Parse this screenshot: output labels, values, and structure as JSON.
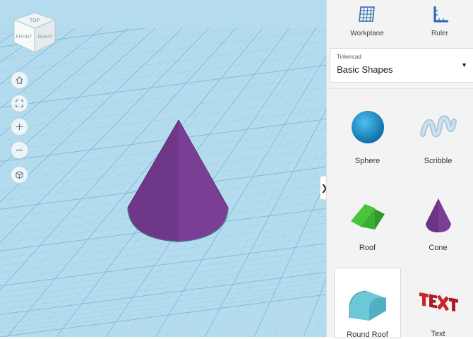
{
  "viewcube": {
    "top": "TOP",
    "front": "FRONT",
    "right": "RIGHT"
  },
  "nav": [
    {
      "name": "home-view-button",
      "icon": "home-icon"
    },
    {
      "name": "fit-view-button",
      "icon": "fit-icon"
    },
    {
      "name": "zoom-in-button",
      "icon": "plus-icon"
    },
    {
      "name": "zoom-out-button",
      "icon": "minus-icon"
    },
    {
      "name": "perspective-button",
      "icon": "cube-icon"
    }
  ],
  "collapse_glyph": "❯",
  "toolbar": {
    "workplane": "Workplane",
    "ruler": "Ruler"
  },
  "library": {
    "source": "Tinkercad",
    "selected": "Basic Shapes"
  },
  "shapes": [
    {
      "label": "Sphere",
      "icon": "sphere-icon"
    },
    {
      "label": "Scribble",
      "icon": "scribble-icon"
    },
    {
      "label": "Roof",
      "icon": "roof-icon"
    },
    {
      "label": "Cone",
      "icon": "cone-icon"
    },
    {
      "label": "Round Roof",
      "icon": "round-roof-icon"
    },
    {
      "label": "Text",
      "icon": "text-icon"
    }
  ],
  "colors": {
    "grid_bg": "#a8d6ea",
    "cone": "#7a3f94",
    "sphere": "#1a8fc9",
    "roof": "#3db33a",
    "round_roof": "#6cc7d6",
    "text_shape": "#c8262a"
  }
}
